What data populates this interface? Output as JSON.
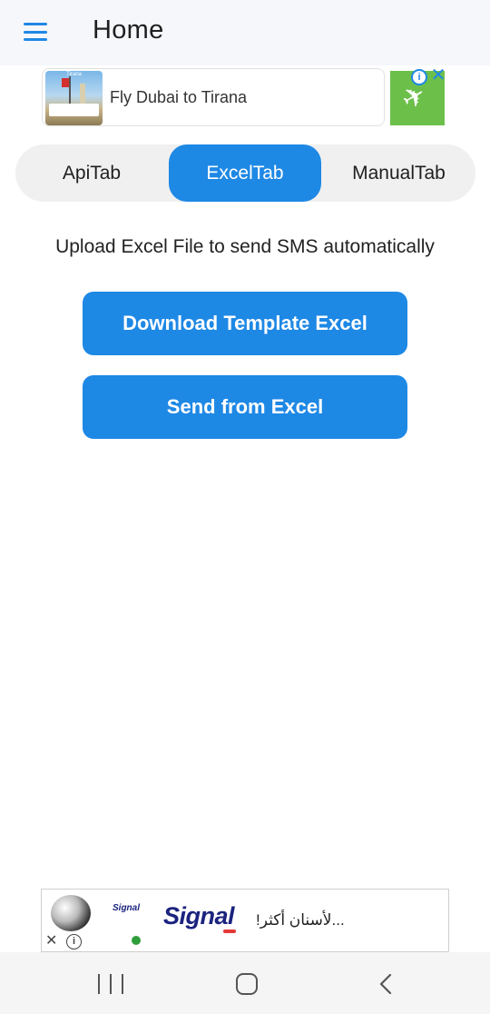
{
  "appbar": {
    "title": "Home",
    "menu_icon": "menu-icon"
  },
  "top_ad": {
    "headline": "Fly Dubai to Tirana",
    "thumb_caption": "Tirana",
    "info_glyph": "i",
    "close_glyph": "✕",
    "logo_glyph": "✈",
    "logo_color": "#6cc04a"
  },
  "tabs": [
    {
      "label": "ApiTab",
      "active": false
    },
    {
      "label": "ExcelTab",
      "active": true
    },
    {
      "label": "ManualTab",
      "active": false
    }
  ],
  "content": {
    "instruction": "Upload Excel File to send SMS automatically",
    "download_button": "Download Template Excel",
    "send_button": "Send from Excel"
  },
  "bottom_ad": {
    "small_logo": "Signal",
    "brand": "Signal",
    "arabic_text": "...لأسنان أكثر!",
    "close_glyph": "✕",
    "info_glyph": "i"
  },
  "colors": {
    "accent": "#1e88e5",
    "appbar_bg": "#f5f7fb",
    "tab_track": "#f0f0f0"
  }
}
